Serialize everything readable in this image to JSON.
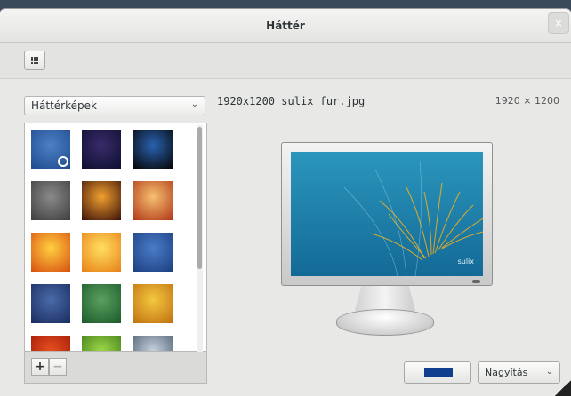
{
  "window": {
    "title": "Háttér",
    "close_glyph": "×"
  },
  "toolbar": {
    "view_icon": "grid-icon"
  },
  "source": {
    "selected": "Háttérképek",
    "chevron": "⌄"
  },
  "thumbnails": [
    {
      "name": "blue-stripes",
      "colors": [
        "#4d7fc4",
        "#1f4b8e"
      ],
      "selected": true
    },
    {
      "name": "bokeh-night",
      "colors": [
        "#3a2a6a",
        "#0c1030"
      ]
    },
    {
      "name": "earth",
      "colors": [
        "#2a62b0",
        "#050505"
      ]
    },
    {
      "name": "grey-drops",
      "colors": [
        "#8a8a8a",
        "#3e3e3e"
      ]
    },
    {
      "name": "sunset-road",
      "colors": [
        "#f0a030",
        "#3a1008"
      ]
    },
    {
      "name": "warm-glow",
      "colors": [
        "#f6c070",
        "#b03818"
      ]
    },
    {
      "name": "orange-flare",
      "colors": [
        "#ffd040",
        "#d85010"
      ]
    },
    {
      "name": "yellow-flare",
      "colors": [
        "#ffe060",
        "#e88018"
      ]
    },
    {
      "name": "blue-lines",
      "colors": [
        "#4a7cc8",
        "#1c3f80"
      ]
    },
    {
      "name": "blue-texture",
      "colors": [
        "#4a6aa8",
        "#1a2c60"
      ]
    },
    {
      "name": "green-texture",
      "colors": [
        "#5aa060",
        "#1c5a2a"
      ]
    },
    {
      "name": "gold-texture",
      "colors": [
        "#f4c840",
        "#c07010"
      ]
    },
    {
      "name": "red-flower",
      "colors": [
        "#e85020",
        "#a01808"
      ]
    },
    {
      "name": "green-grass",
      "colors": [
        "#a0d848",
        "#3a7a18"
      ]
    },
    {
      "name": "cloud-sky",
      "colors": [
        "#c8d4e0",
        "#4a5a70"
      ]
    }
  ],
  "list_controls": {
    "add": "+",
    "remove": "−"
  },
  "preview": {
    "filename": "1920x1200_sulix_fur.jpg",
    "resolution": "1920 × 1200",
    "brand": "sulix"
  },
  "bottom": {
    "color_swatch": "#103f8f",
    "mode_selected": "Nagyítás",
    "chevron": "⌄"
  }
}
